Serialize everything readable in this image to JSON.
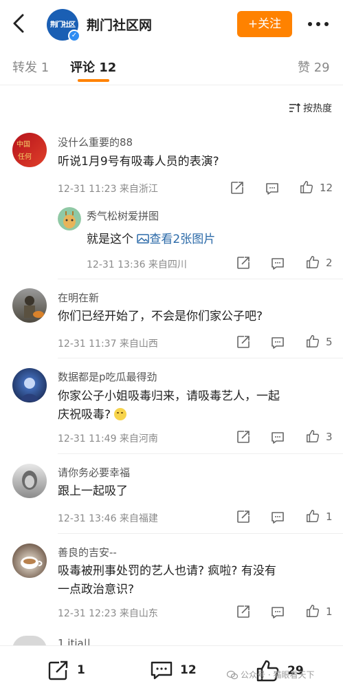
{
  "header": {
    "title": "荆门社区网",
    "avatar_text": "荆门社区",
    "follow_label": "+关注"
  },
  "tabs": [
    {
      "label": "转发 1"
    },
    {
      "label": "评论 12"
    },
    {
      "label": "赞 29"
    }
  ],
  "sort_label": "按热度",
  "comments": [
    {
      "name": "没什么重要的88",
      "text": "听说1月9号有吸毒人员的表演?",
      "meta": "12-31 11:23  来自浙江",
      "likes": "12",
      "reply": {
        "name": "秀气松树爱拼图",
        "text": "就是这个",
        "link": "查看2张图片",
        "meta": "12-31 13:36  来自四川",
        "likes": "2"
      }
    },
    {
      "name": "在明在新",
      "text": "你们已经开始了，不会是你们家公子吧?",
      "meta": "12-31 11:37  来自山西",
      "likes": "5"
    },
    {
      "name": "数据都是p吃瓜最得劲",
      "text_line1": "你家公子小姐吸毒归来，请吸毒艺人，一起",
      "text_line2": "庆祝吸毒?",
      "meta": "12-31 11:49  来自河南",
      "likes": "3"
    },
    {
      "name": "请你务必要幸福",
      "text": "跟上一起吸了",
      "meta": "12-31 13:46  来自福建",
      "likes": "1"
    },
    {
      "name": "善良的吉安--",
      "text_line1": "吸毒被刑事处罚的艺人也请? 疯啦? 有没有",
      "text_line2": "一点政治意识?",
      "meta": "12-31 12:23  来自山东",
      "likes": "1"
    }
  ],
  "peek_name": "1.itia||",
  "bottom_bar": {
    "repost_count": "1",
    "comment_count": "12",
    "like_count": "29"
  },
  "watermark": "公众号 · 猫眼看天下"
}
